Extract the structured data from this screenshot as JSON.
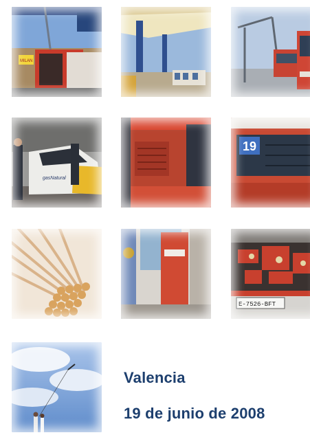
{
  "photos": [
    {
      "name": "fuel-station-truck-photo"
    },
    {
      "name": "fuel-station-canopy-photo"
    },
    {
      "name": "bus-charging-photo"
    },
    {
      "name": "taxi-photo"
    },
    {
      "name": "red-bus-side-photo"
    },
    {
      "name": "bus-19-front-photo"
    },
    {
      "name": "matches-photo"
    },
    {
      "name": "bus-rear-photo"
    },
    {
      "name": "bus-engine-photo"
    },
    {
      "name": "sky-kite-photo"
    }
  ],
  "tile_text": {
    "truck_sign": "MILAN",
    "taxi_brand": "gasNatural",
    "bus_route": "19",
    "plate": "E-7526-BFT"
  },
  "caption": {
    "city": "Valencia",
    "date": "19 de junio de 2008"
  },
  "colors": {
    "caption": "#1d3f6e",
    "bus_red": "#d8452e",
    "sky_blue": "#6f9ad1"
  }
}
